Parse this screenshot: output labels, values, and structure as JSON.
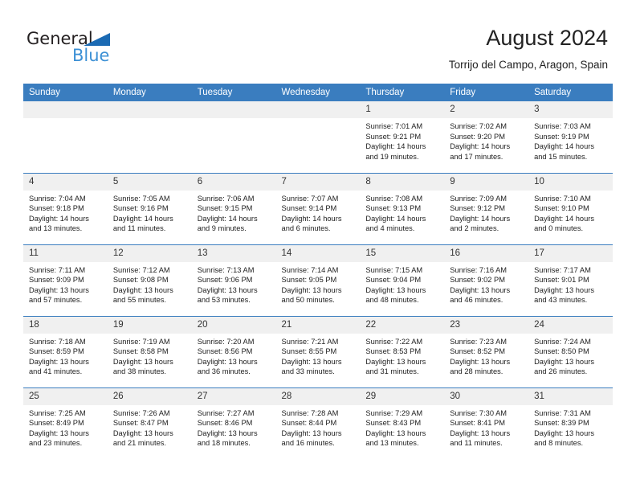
{
  "brand": {
    "name_part1": "General",
    "name_part2": "Blue",
    "triangle_icon": "triangle-icon",
    "colors": {
      "dark": "#231f20",
      "blue": "#3c90d5",
      "triangle": "#1b6ab3"
    }
  },
  "header": {
    "title": "August 2024",
    "subtitle": "Torrijo del Campo, Aragon, Spain"
  },
  "calendar": {
    "accent_color": "#3a7dbf",
    "daynum_bg": "#f0f0f0",
    "weekday_headers": [
      "Sunday",
      "Monday",
      "Tuesday",
      "Wednesday",
      "Thursday",
      "Friday",
      "Saturday"
    ],
    "weeks": [
      [
        {
          "day": "",
          "empty": true,
          "lines": []
        },
        {
          "day": "",
          "empty": true,
          "lines": []
        },
        {
          "day": "",
          "empty": true,
          "lines": []
        },
        {
          "day": "",
          "empty": true,
          "lines": []
        },
        {
          "day": "1",
          "empty": false,
          "lines": [
            "Sunrise: 7:01 AM",
            "Sunset: 9:21 PM",
            "Daylight: 14 hours",
            "and 19 minutes."
          ]
        },
        {
          "day": "2",
          "empty": false,
          "lines": [
            "Sunrise: 7:02 AM",
            "Sunset: 9:20 PM",
            "Daylight: 14 hours",
            "and 17 minutes."
          ]
        },
        {
          "day": "3",
          "empty": false,
          "lines": [
            "Sunrise: 7:03 AM",
            "Sunset: 9:19 PM",
            "Daylight: 14 hours",
            "and 15 minutes."
          ]
        }
      ],
      [
        {
          "day": "4",
          "empty": false,
          "lines": [
            "Sunrise: 7:04 AM",
            "Sunset: 9:18 PM",
            "Daylight: 14 hours",
            "and 13 minutes."
          ]
        },
        {
          "day": "5",
          "empty": false,
          "lines": [
            "Sunrise: 7:05 AM",
            "Sunset: 9:16 PM",
            "Daylight: 14 hours",
            "and 11 minutes."
          ]
        },
        {
          "day": "6",
          "empty": false,
          "lines": [
            "Sunrise: 7:06 AM",
            "Sunset: 9:15 PM",
            "Daylight: 14 hours",
            "and 9 minutes."
          ]
        },
        {
          "day": "7",
          "empty": false,
          "lines": [
            "Sunrise: 7:07 AM",
            "Sunset: 9:14 PM",
            "Daylight: 14 hours",
            "and 6 minutes."
          ]
        },
        {
          "day": "8",
          "empty": false,
          "lines": [
            "Sunrise: 7:08 AM",
            "Sunset: 9:13 PM",
            "Daylight: 14 hours",
            "and 4 minutes."
          ]
        },
        {
          "day": "9",
          "empty": false,
          "lines": [
            "Sunrise: 7:09 AM",
            "Sunset: 9:12 PM",
            "Daylight: 14 hours",
            "and 2 minutes."
          ]
        },
        {
          "day": "10",
          "empty": false,
          "lines": [
            "Sunrise: 7:10 AM",
            "Sunset: 9:10 PM",
            "Daylight: 14 hours",
            "and 0 minutes."
          ]
        }
      ],
      [
        {
          "day": "11",
          "empty": false,
          "lines": [
            "Sunrise: 7:11 AM",
            "Sunset: 9:09 PM",
            "Daylight: 13 hours",
            "and 57 minutes."
          ]
        },
        {
          "day": "12",
          "empty": false,
          "lines": [
            "Sunrise: 7:12 AM",
            "Sunset: 9:08 PM",
            "Daylight: 13 hours",
            "and 55 minutes."
          ]
        },
        {
          "day": "13",
          "empty": false,
          "lines": [
            "Sunrise: 7:13 AM",
            "Sunset: 9:06 PM",
            "Daylight: 13 hours",
            "and 53 minutes."
          ]
        },
        {
          "day": "14",
          "empty": false,
          "lines": [
            "Sunrise: 7:14 AM",
            "Sunset: 9:05 PM",
            "Daylight: 13 hours",
            "and 50 minutes."
          ]
        },
        {
          "day": "15",
          "empty": false,
          "lines": [
            "Sunrise: 7:15 AM",
            "Sunset: 9:04 PM",
            "Daylight: 13 hours",
            "and 48 minutes."
          ]
        },
        {
          "day": "16",
          "empty": false,
          "lines": [
            "Sunrise: 7:16 AM",
            "Sunset: 9:02 PM",
            "Daylight: 13 hours",
            "and 46 minutes."
          ]
        },
        {
          "day": "17",
          "empty": false,
          "lines": [
            "Sunrise: 7:17 AM",
            "Sunset: 9:01 PM",
            "Daylight: 13 hours",
            "and 43 minutes."
          ]
        }
      ],
      [
        {
          "day": "18",
          "empty": false,
          "lines": [
            "Sunrise: 7:18 AM",
            "Sunset: 8:59 PM",
            "Daylight: 13 hours",
            "and 41 minutes."
          ]
        },
        {
          "day": "19",
          "empty": false,
          "lines": [
            "Sunrise: 7:19 AM",
            "Sunset: 8:58 PM",
            "Daylight: 13 hours",
            "and 38 minutes."
          ]
        },
        {
          "day": "20",
          "empty": false,
          "lines": [
            "Sunrise: 7:20 AM",
            "Sunset: 8:56 PM",
            "Daylight: 13 hours",
            "and 36 minutes."
          ]
        },
        {
          "day": "21",
          "empty": false,
          "lines": [
            "Sunrise: 7:21 AM",
            "Sunset: 8:55 PM",
            "Daylight: 13 hours",
            "and 33 minutes."
          ]
        },
        {
          "day": "22",
          "empty": false,
          "lines": [
            "Sunrise: 7:22 AM",
            "Sunset: 8:53 PM",
            "Daylight: 13 hours",
            "and 31 minutes."
          ]
        },
        {
          "day": "23",
          "empty": false,
          "lines": [
            "Sunrise: 7:23 AM",
            "Sunset: 8:52 PM",
            "Daylight: 13 hours",
            "and 28 minutes."
          ]
        },
        {
          "day": "24",
          "empty": false,
          "lines": [
            "Sunrise: 7:24 AM",
            "Sunset: 8:50 PM",
            "Daylight: 13 hours",
            "and 26 minutes."
          ]
        }
      ],
      [
        {
          "day": "25",
          "empty": false,
          "lines": [
            "Sunrise: 7:25 AM",
            "Sunset: 8:49 PM",
            "Daylight: 13 hours",
            "and 23 minutes."
          ]
        },
        {
          "day": "26",
          "empty": false,
          "lines": [
            "Sunrise: 7:26 AM",
            "Sunset: 8:47 PM",
            "Daylight: 13 hours",
            "and 21 minutes."
          ]
        },
        {
          "day": "27",
          "empty": false,
          "lines": [
            "Sunrise: 7:27 AM",
            "Sunset: 8:46 PM",
            "Daylight: 13 hours",
            "and 18 minutes."
          ]
        },
        {
          "day": "28",
          "empty": false,
          "lines": [
            "Sunrise: 7:28 AM",
            "Sunset: 8:44 PM",
            "Daylight: 13 hours",
            "and 16 minutes."
          ]
        },
        {
          "day": "29",
          "empty": false,
          "lines": [
            "Sunrise: 7:29 AM",
            "Sunset: 8:43 PM",
            "Daylight: 13 hours",
            "and 13 minutes."
          ]
        },
        {
          "day": "30",
          "empty": false,
          "lines": [
            "Sunrise: 7:30 AM",
            "Sunset: 8:41 PM",
            "Daylight: 13 hours",
            "and 11 minutes."
          ]
        },
        {
          "day": "31",
          "empty": false,
          "lines": [
            "Sunrise: 7:31 AM",
            "Sunset: 8:39 PM",
            "Daylight: 13 hours",
            "and 8 minutes."
          ]
        }
      ]
    ]
  }
}
